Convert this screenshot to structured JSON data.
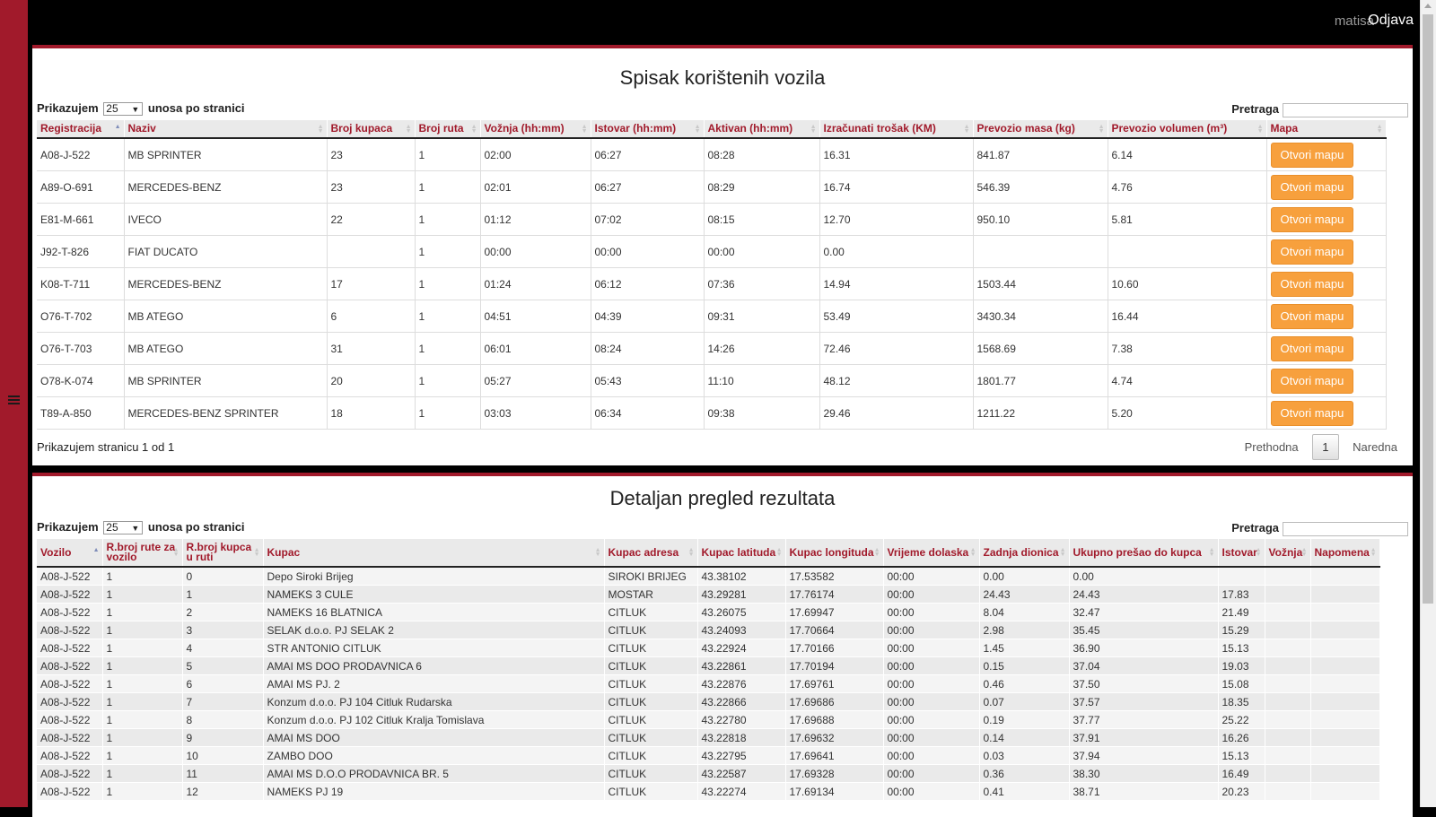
{
  "header": {
    "username": "matisa",
    "logout_label": "Odjava"
  },
  "vehicles": {
    "title": "Spisak korištenih vozila",
    "length_prefix": "Prikazujem",
    "length_value": "25",
    "length_suffix": "unosa po stranici",
    "search_label": "Pretraga",
    "columns": [
      "Registracija",
      "Naziv",
      "Broj kupaca",
      "Broj ruta",
      "Vožnja (hh:mm)",
      "Istovar (hh:mm)",
      "Aktivan (hh:mm)",
      "Izračunati trošak (KM)",
      "Prevozio masa (kg)",
      "Prevozio volumen (m³)",
      "Mapa"
    ],
    "map_button_label": "Otvori mapu",
    "rows": [
      [
        "A08-J-522",
        "MB SPRINTER",
        "23",
        "1",
        "02:00",
        "06:27",
        "08:28",
        "16.31",
        "841.87",
        "6.14"
      ],
      [
        "A89-O-691",
        "MERCEDES-BENZ",
        "23",
        "1",
        "02:01",
        "06:27",
        "08:29",
        "16.74",
        "546.39",
        "4.76"
      ],
      [
        "E81-M-661",
        "IVECO",
        "22",
        "1",
        "01:12",
        "07:02",
        "08:15",
        "12.70",
        "950.10",
        "5.81"
      ],
      [
        "J92-T-826",
        "FIAT DUCATO",
        "",
        "1",
        "00:00",
        "00:00",
        "00:00",
        "0.00",
        "",
        ""
      ],
      [
        "K08-T-711",
        "MERCEDES-BENZ",
        "17",
        "1",
        "01:24",
        "06:12",
        "07:36",
        "14.94",
        "1503.44",
        "10.60"
      ],
      [
        "O76-T-702",
        "MB ATEGO",
        "6",
        "1",
        "04:51",
        "04:39",
        "09:31",
        "53.49",
        "3430.34",
        "16.44"
      ],
      [
        "O76-T-703",
        "MB ATEGO",
        "31",
        "1",
        "06:01",
        "08:24",
        "14:26",
        "72.46",
        "1568.69",
        "7.38"
      ],
      [
        "O78-K-074",
        "MB SPRINTER",
        "20",
        "1",
        "05:27",
        "05:43",
        "11:10",
        "48.12",
        "1801.77",
        "4.74"
      ],
      [
        "T89-A-850",
        "MERCEDES-BENZ SPRINTER",
        "18",
        "1",
        "03:03",
        "06:34",
        "09:38",
        "29.46",
        "1211.22",
        "5.20"
      ]
    ],
    "page_info": "Prikazujem stranicu 1 od 1",
    "prev_label": "Prethodna",
    "current_page": "1",
    "next_label": "Naredna"
  },
  "details": {
    "title": "Detaljan pregled rezultata",
    "length_prefix": "Prikazujem",
    "length_value": "25",
    "length_suffix": "unosa po stranici",
    "search_label": "Pretraga",
    "columns": [
      "Vozilo",
      "R.broj rute za vozilo",
      "R.broj kupca u ruti",
      "Kupac",
      "Kupac adresa",
      "Kupac latituda",
      "Kupac longituda",
      "Vrijeme dolaska",
      "Zadnja dionica",
      "Ukupno prešao do kupca",
      "Istovar",
      "Vožnja",
      "Napomena"
    ],
    "rows": [
      [
        "A08-J-522",
        "1",
        "0",
        "Depo Siroki Brijeg",
        "SIROKI BRIJEG",
        "43.38102",
        "17.53582",
        "00:00",
        "0.00",
        "0.00",
        "",
        "",
        ""
      ],
      [
        "A08-J-522",
        "1",
        "1",
        "NAMEKS 3 CULE",
        "MOSTAR",
        "43.29281",
        "17.76174",
        "00:00",
        "24.43",
        "24.43",
        "17.83",
        "",
        ""
      ],
      [
        "A08-J-522",
        "1",
        "2",
        "NAMEKS 16 BLATNICA",
        "CITLUK",
        "43.26075",
        "17.69947",
        "00:00",
        "8.04",
        "32.47",
        "21.49",
        "",
        ""
      ],
      [
        "A08-J-522",
        "1",
        "3",
        "SELAK d.o.o. PJ SELAK 2",
        "CITLUK",
        "43.24093",
        "17.70664",
        "00:00",
        "2.98",
        "35.45",
        "15.29",
        "",
        ""
      ],
      [
        "A08-J-522",
        "1",
        "4",
        "STR ANTONIO CITLUK",
        "CITLUK",
        "43.22924",
        "17.70166",
        "00:00",
        "1.45",
        "36.90",
        "15.13",
        "",
        ""
      ],
      [
        "A08-J-522",
        "1",
        "5",
        "AMAI MS DOO PRODAVNICA 6",
        "CITLUK",
        "43.22861",
        "17.70194",
        "00:00",
        "0.15",
        "37.04",
        "19.03",
        "",
        ""
      ],
      [
        "A08-J-522",
        "1",
        "6",
        "AMAI MS PJ. 2",
        "CITLUK",
        "43.22876",
        "17.69761",
        "00:00",
        "0.46",
        "37.50",
        "15.08",
        "",
        ""
      ],
      [
        "A08-J-522",
        "1",
        "7",
        "Konzum d.o.o. PJ 104 Citluk Rudarska",
        "CITLUK",
        "43.22866",
        "17.69686",
        "00:00",
        "0.07",
        "37.57",
        "18.35",
        "",
        ""
      ],
      [
        "A08-J-522",
        "1",
        "8",
        "Konzum d.o.o. PJ 102 Citluk Kralja Tomislava",
        "CITLUK",
        "43.22780",
        "17.69688",
        "00:00",
        "0.19",
        "37.77",
        "25.22",
        "",
        ""
      ],
      [
        "A08-J-522",
        "1",
        "9",
        "AMAI MS DOO",
        "CITLUK",
        "43.22818",
        "17.69632",
        "00:00",
        "0.14",
        "37.91",
        "16.26",
        "",
        ""
      ],
      [
        "A08-J-522",
        "1",
        "10",
        "ZAMBO DOO",
        "CITLUK",
        "43.22795",
        "17.69641",
        "00:00",
        "0.03",
        "37.94",
        "15.13",
        "",
        ""
      ],
      [
        "A08-J-522",
        "1",
        "11",
        "AMAI MS D.O.O PRODAVNICA BR. 5",
        "CITLUK",
        "43.22587",
        "17.69328",
        "00:00",
        "0.36",
        "38.30",
        "16.49",
        "",
        ""
      ],
      [
        "A08-J-522",
        "1",
        "12",
        "NAMEKS PJ 19",
        "CITLUK",
        "43.22274",
        "17.69134",
        "00:00",
        "0.41",
        "38.71",
        "20.23",
        "",
        ""
      ]
    ]
  },
  "colors": {
    "brand_red": "#a11a2b",
    "button_orange": "#f7a03d",
    "header_text": "#a11a2b"
  },
  "icons": {
    "menu": "menu-icon"
  }
}
